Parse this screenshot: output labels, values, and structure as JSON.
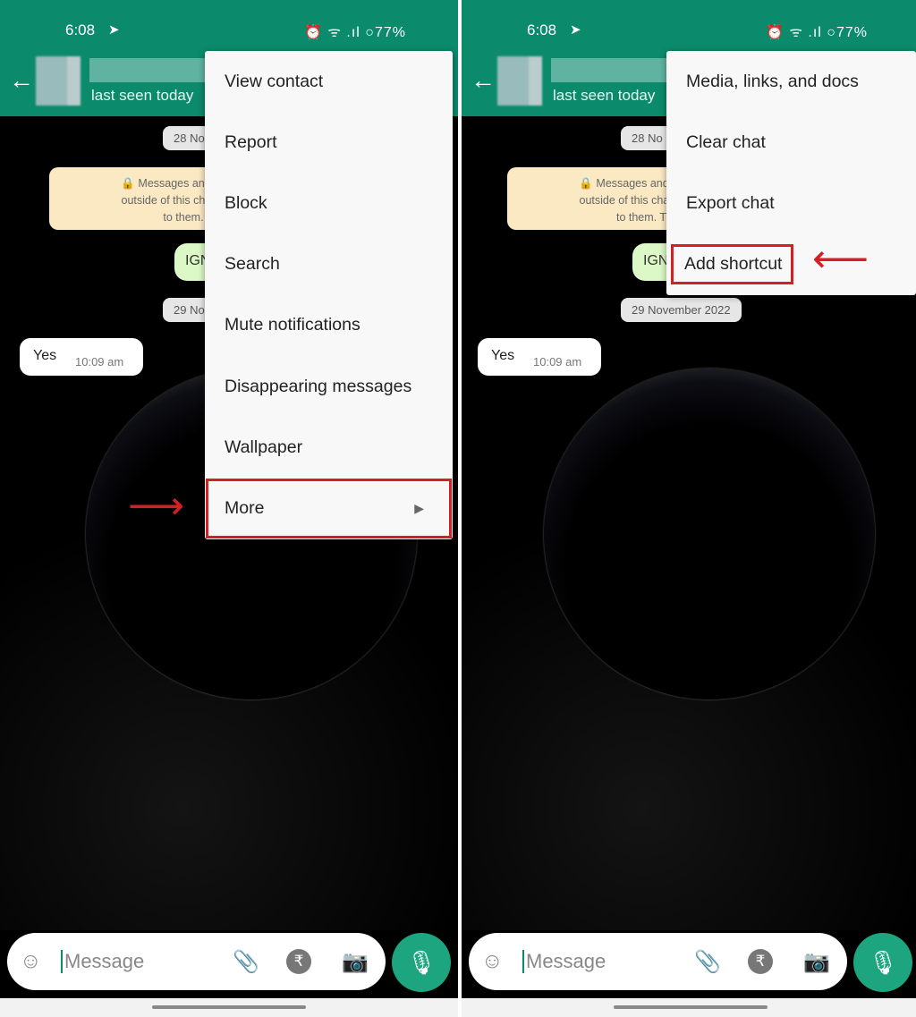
{
  "status": {
    "time": "6:08",
    "icons": "⏰ ᯤ .ıl ○",
    "battery": "77%"
  },
  "header": {
    "last_seen": "last seen today"
  },
  "chat": {
    "date1": "28 No",
    "notice_lines": [
      "🔒 Messages and calls a",
      "outside of this chat, not e",
      "to them."
    ],
    "notice_lines_right": [
      "🔒 Messages and calls a",
      "outside of this chat, not e",
      "to them. T"
    ],
    "sent_msg": "IGN",
    "date2_left": "29 No",
    "date2_right": "29 November 2022",
    "received_msg": "Yes",
    "received_time": "10:09 am"
  },
  "menu_left": {
    "items": [
      "View contact",
      "Report",
      "Block",
      "Search",
      "Mute notifications",
      "Disappearing messages",
      "Wallpaper",
      "More"
    ],
    "highlighted": "More"
  },
  "menu_right": {
    "items": [
      "Media, links, and docs",
      "Clear chat",
      "Export chat",
      "Add shortcut"
    ],
    "highlighted": "Add shortcut"
  },
  "input": {
    "placeholder": "Message"
  },
  "colors": {
    "header": "#0b8a6c",
    "highlight": "#d32027",
    "mic": "#1da57f"
  }
}
